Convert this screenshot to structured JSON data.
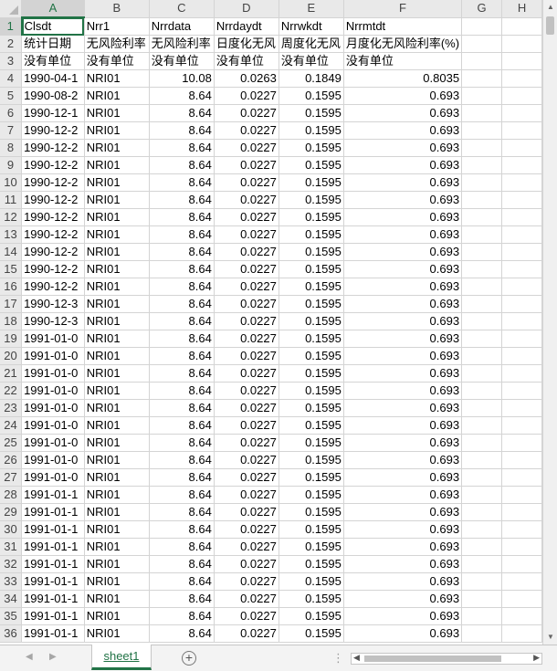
{
  "columns": [
    "A",
    "B",
    "C",
    "D",
    "E",
    "F",
    "G",
    "H"
  ],
  "active_column": "A",
  "active_row": 1,
  "header_rows": [
    [
      "Clsdt",
      "Nrr1",
      "Nrrdata",
      "Nrrdaydt",
      "Nrrwkdt",
      "Nrrmtdt"
    ],
    [
      "统计日期",
      "无风险利率",
      "无风险利率",
      "日度化无风",
      "周度化无风",
      "月度化无风险利率(%)"
    ],
    [
      "没有单位",
      "没有单位",
      "没有单位",
      "没有单位",
      "没有单位",
      "没有单位"
    ]
  ],
  "data_rows": [
    [
      "1990-04-1",
      "NRI01",
      "10.08",
      "0.0263",
      "0.1849",
      "0.8035"
    ],
    [
      "1990-08-2",
      "NRI01",
      "8.64",
      "0.0227",
      "0.1595",
      "0.693"
    ],
    [
      "1990-12-1",
      "NRI01",
      "8.64",
      "0.0227",
      "0.1595",
      "0.693"
    ],
    [
      "1990-12-2",
      "NRI01",
      "8.64",
      "0.0227",
      "0.1595",
      "0.693"
    ],
    [
      "1990-12-2",
      "NRI01",
      "8.64",
      "0.0227",
      "0.1595",
      "0.693"
    ],
    [
      "1990-12-2",
      "NRI01",
      "8.64",
      "0.0227",
      "0.1595",
      "0.693"
    ],
    [
      "1990-12-2",
      "NRI01",
      "8.64",
      "0.0227",
      "0.1595",
      "0.693"
    ],
    [
      "1990-12-2",
      "NRI01",
      "8.64",
      "0.0227",
      "0.1595",
      "0.693"
    ],
    [
      "1990-12-2",
      "NRI01",
      "8.64",
      "0.0227",
      "0.1595",
      "0.693"
    ],
    [
      "1990-12-2",
      "NRI01",
      "8.64",
      "0.0227",
      "0.1595",
      "0.693"
    ],
    [
      "1990-12-2",
      "NRI01",
      "8.64",
      "0.0227",
      "0.1595",
      "0.693"
    ],
    [
      "1990-12-2",
      "NRI01",
      "8.64",
      "0.0227",
      "0.1595",
      "0.693"
    ],
    [
      "1990-12-2",
      "NRI01",
      "8.64",
      "0.0227",
      "0.1595",
      "0.693"
    ],
    [
      "1990-12-3",
      "NRI01",
      "8.64",
      "0.0227",
      "0.1595",
      "0.693"
    ],
    [
      "1990-12-3",
      "NRI01",
      "8.64",
      "0.0227",
      "0.1595",
      "0.693"
    ],
    [
      "1991-01-0",
      "NRI01",
      "8.64",
      "0.0227",
      "0.1595",
      "0.693"
    ],
    [
      "1991-01-0",
      "NRI01",
      "8.64",
      "0.0227",
      "0.1595",
      "0.693"
    ],
    [
      "1991-01-0",
      "NRI01",
      "8.64",
      "0.0227",
      "0.1595",
      "0.693"
    ],
    [
      "1991-01-0",
      "NRI01",
      "8.64",
      "0.0227",
      "0.1595",
      "0.693"
    ],
    [
      "1991-01-0",
      "NRI01",
      "8.64",
      "0.0227",
      "0.1595",
      "0.693"
    ],
    [
      "1991-01-0",
      "NRI01",
      "8.64",
      "0.0227",
      "0.1595",
      "0.693"
    ],
    [
      "1991-01-0",
      "NRI01",
      "8.64",
      "0.0227",
      "0.1595",
      "0.693"
    ],
    [
      "1991-01-0",
      "NRI01",
      "8.64",
      "0.0227",
      "0.1595",
      "0.693"
    ],
    [
      "1991-01-0",
      "NRI01",
      "8.64",
      "0.0227",
      "0.1595",
      "0.693"
    ],
    [
      "1991-01-1",
      "NRI01",
      "8.64",
      "0.0227",
      "0.1595",
      "0.693"
    ],
    [
      "1991-01-1",
      "NRI01",
      "8.64",
      "0.0227",
      "0.1595",
      "0.693"
    ],
    [
      "1991-01-1",
      "NRI01",
      "8.64",
      "0.0227",
      "0.1595",
      "0.693"
    ],
    [
      "1991-01-1",
      "NRI01",
      "8.64",
      "0.0227",
      "0.1595",
      "0.693"
    ],
    [
      "1991-01-1",
      "NRI01",
      "8.64",
      "0.0227",
      "0.1595",
      "0.693"
    ],
    [
      "1991-01-1",
      "NRI01",
      "8.64",
      "0.0227",
      "0.1595",
      "0.693"
    ],
    [
      "1991-01-1",
      "NRI01",
      "8.64",
      "0.0227",
      "0.1595",
      "0.693"
    ],
    [
      "1991-01-1",
      "NRI01",
      "8.64",
      "0.0227",
      "0.1595",
      "0.693"
    ],
    [
      "1991-01-1",
      "NRI01",
      "8.64",
      "0.0227",
      "0.1595",
      "0.693"
    ]
  ],
  "tabs": {
    "sheet_name": "sheet1",
    "add_label": "+",
    "menu_label": "⋮"
  },
  "colors": {
    "accent": "#217346",
    "gridline": "#d4d4d4",
    "header_bg": "#e9e9e9"
  }
}
